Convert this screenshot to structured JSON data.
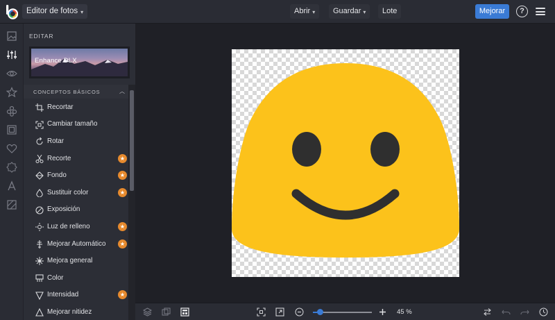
{
  "header": {
    "app_menu": "Editor de fotos",
    "menus": [
      "Abrir",
      "Guardar",
      "Lote"
    ],
    "primary_action": "Mejorar",
    "help_glyph": "?"
  },
  "rail": {
    "icons": [
      "image-icon",
      "sliders-icon",
      "eye-icon",
      "star-icon",
      "sticker-icon",
      "frame-icon",
      "heart-icon",
      "badge-icon",
      "text-icon",
      "texture-icon"
    ],
    "active": "sliders-icon"
  },
  "panel": {
    "title": "EDITAR",
    "enhance_card": "Enhance DLX",
    "section": "CONCEPTOS BÁSICOS",
    "tools": [
      {
        "label": "Recortar",
        "icon": "crop-icon",
        "premium": false
      },
      {
        "label": "Cambiar tamaño",
        "icon": "resize-icon",
        "premium": false
      },
      {
        "label": "Rotar",
        "icon": "rotate-icon",
        "premium": false
      },
      {
        "label": "Recorte",
        "icon": "scissors-icon",
        "premium": true
      },
      {
        "label": "Fondo",
        "icon": "background-icon",
        "premium": true
      },
      {
        "label": "Sustituir color",
        "icon": "color-drop-icon",
        "premium": true
      },
      {
        "label": "Exposición",
        "icon": "exposure-icon",
        "premium": false
      },
      {
        "label": "Luz de relleno",
        "icon": "fill-light-icon",
        "premium": true
      },
      {
        "label": "Mejorar Automático",
        "icon": "auto-enhance-icon",
        "premium": true
      },
      {
        "label": "Mejora general",
        "icon": "sparkle-icon",
        "premium": false
      },
      {
        "label": "Color",
        "icon": "palette-icon",
        "premium": false
      },
      {
        "label": "Intensidad",
        "icon": "intensity-icon",
        "premium": true
      },
      {
        "label": "Mejorar nitidez",
        "icon": "sharpen-icon",
        "premium": false
      }
    ]
  },
  "zoom": {
    "value_label": "45 %",
    "fraction": 0.12
  },
  "colors": {
    "accent": "#3a7bd5",
    "premium_badge": "#e68a2e",
    "emoji_face": "#fcc21b",
    "emoji_features": "#2f2f2f"
  }
}
